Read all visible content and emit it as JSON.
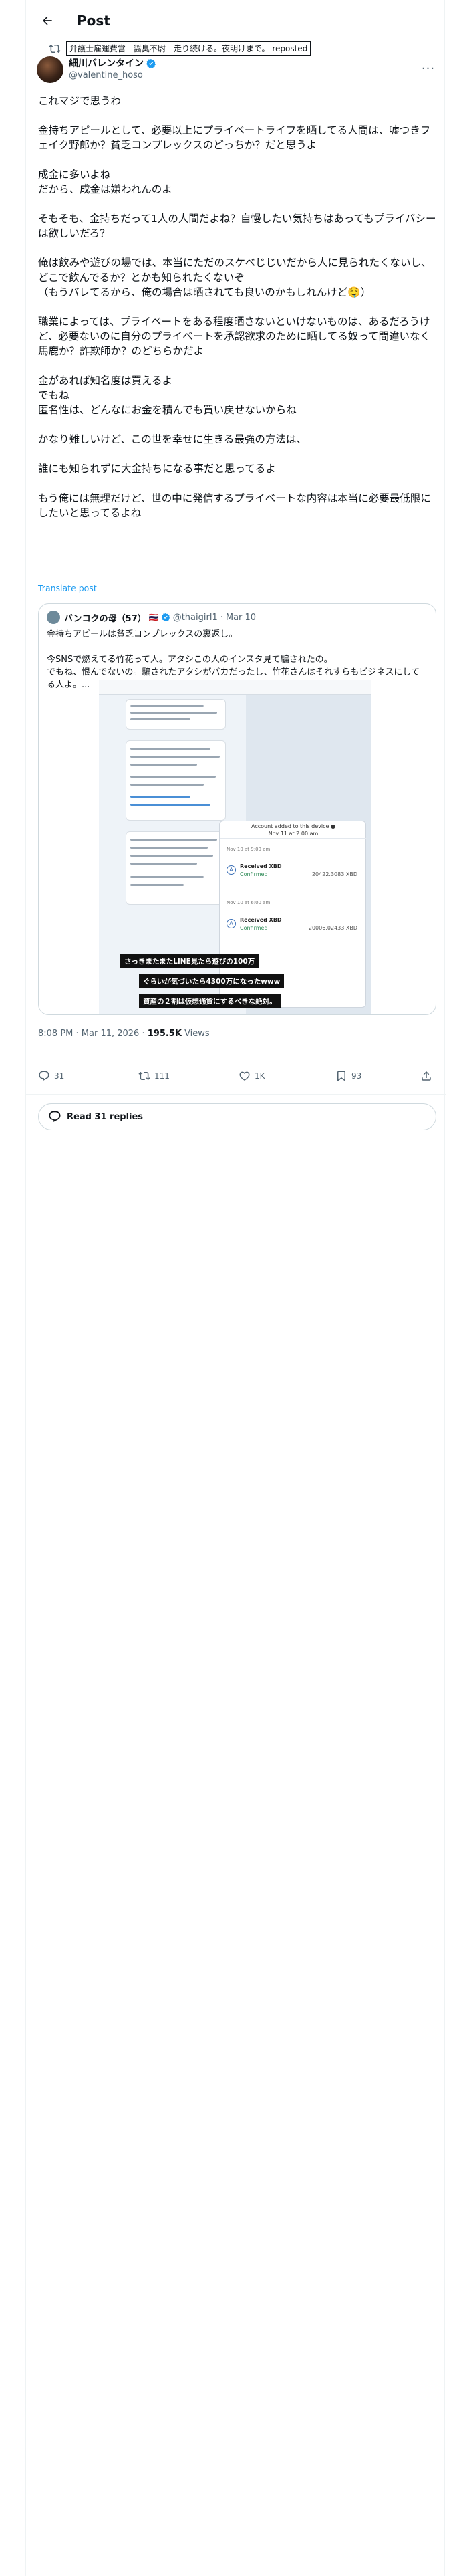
{
  "header": {
    "title": "Post"
  },
  "repost": {
    "text": "弁護士雇運費営　醤臭不尉　走り続ける。夜明けまで。 reposted"
  },
  "author": {
    "name": "細川バレンタイン",
    "handle": "@valentine_hoso"
  },
  "post": {
    "body": "これマジで思うわ\n\n金持ちアピールとして、必要以上にプライベートライフを晒してる人間は、嘘つきフェイク野郎か？貧乏コンプレックスのどっちか？だと思うよ\n\n成金に多いよね\nだから、成金は嫌われんのよ\n\nそもそも、金持ちだって1人の人間だよね？自慢したい気持ちはあってもプライバシーは欲しいだろ？\n\n俺は飲みや遊びの場では、本当にただのスケベじじいだから人に見られたくないし、どこで飲んでるか？とかも知られたくないぞ\n（もうバレてるから、俺の場合は晒されても良いのかもしれんけど🤤）\n\n職業によっては、プライベートをある程度晒さないといけないものは、あるだろうけど、必要ないのに自分のプライベートを承認欲求のために晒してる奴って間違いなく馬鹿か？詐欺師か？のどちらかだよ\n\n金があれば知名度は買えるよ\nでもね\n匿名性は、どんなにお金を積んでも買い戻せないからね\n\nかなり難しいけど、この世を幸せに生きる最強の方法は、\n\n誰にも知られずに大金持ちになる事だと思ってるよ\n\nもう俺には無理だけど、世の中に発信するプライベートな内容は本当に必要最低限にしたいと思ってるよね",
    "translate": "Translate post"
  },
  "quote": {
    "name": "バンコクの母（57）",
    "flag": "🇹🇭",
    "handle": "@thaigirl1",
    "date": "Mar 10",
    "text": "金持ちアピールは貧乏コンプレックスの裏返し。\n\n今SNSで燃えてる竹花って人。アタシこの人のインスタ見て騙されたの。\nでもね、恨んでないの。騙されたアタシがバカだったし、竹花さんはそれすらもビジネスにしてる人よ。...",
    "wallet_head": "Account added to this device ●\nNov 11 at 2:00 am",
    "wallet_items": [
      {
        "label": "Received XBD",
        "status": "Confirmed",
        "amount": "20422.3083 XBD",
        "date": "Nov 10 at 9:00 am"
      },
      {
        "label": "Received XBD",
        "status": "Confirmed",
        "amount": "20006.02433 XBD",
        "date": "Nov 10 at 6:00 am"
      }
    ],
    "captions": [
      "さっきまたまたLINE見たら遊びの100万",
      "ぐらいが気づいたら4300万になったwww",
      "資産の２割は仮想通貨にするべきな絶対。"
    ]
  },
  "meta": {
    "time": "8:08 PM · Mar 11, 2026 · ",
    "views_count": "195.5K",
    "views_label": " Views"
  },
  "actions": {
    "replies": "31",
    "reposts": "111",
    "likes": "1K",
    "bookmarks": "93"
  },
  "read_replies": "Read 31 replies",
  "colors": {
    "accent": "#1d9bf0",
    "text": "#0f1419",
    "muted": "#536471",
    "border": "#cfd9de"
  }
}
